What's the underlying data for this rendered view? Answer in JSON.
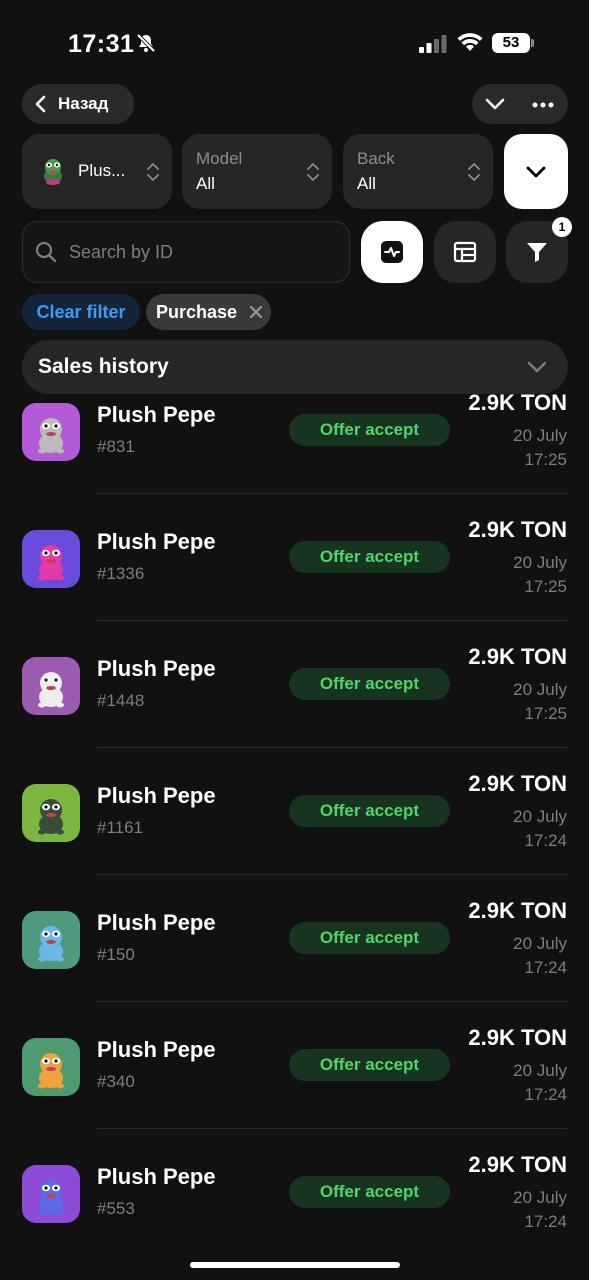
{
  "status_bar": {
    "time": "17:31",
    "battery": "53"
  },
  "nav": {
    "back_label": "Назад"
  },
  "filters": {
    "collection_value": "Plus...",
    "model_label": "Model",
    "model_value": "All",
    "back_label": "Back",
    "back_value": "All"
  },
  "search": {
    "placeholder": "Search by ID"
  },
  "filter_badge": "1",
  "chips": {
    "clear_label": "Clear filter",
    "purchase_label": "Purchase"
  },
  "section": {
    "title": "Sales history"
  },
  "colors": {
    "accent_blue": "#3d9bf2",
    "tag_green": "#4fd66a",
    "background": "#111111"
  },
  "sales": [
    {
      "name": "Plush Pepe",
      "number": "#831",
      "type": "Offer accept",
      "price": "2.9K TON",
      "date": "20 July",
      "time": "17:25",
      "bg": "#b35ad9",
      "toy": "#bbbbbb"
    },
    {
      "name": "Plush Pepe",
      "number": "#1336",
      "type": "Offer accept",
      "price": "2.9K TON",
      "date": "20 July",
      "time": "17:25",
      "bg": "#6a4bdc",
      "toy": "#e23aa8"
    },
    {
      "name": "Plush Pepe",
      "number": "#1448",
      "type": "Offer accept",
      "price": "2.9K TON",
      "date": "20 July",
      "time": "17:25",
      "bg": "#9a5bb0",
      "toy": "#eeeeee"
    },
    {
      "name": "Plush Pepe",
      "number": "#1161",
      "type": "Offer accept",
      "price": "2.9K TON",
      "date": "20 July",
      "time": "17:24",
      "bg": "#7bb63f",
      "toy": "#3c4c3c"
    },
    {
      "name": "Plush Pepe",
      "number": "#150",
      "type": "Offer accept",
      "price": "2.9K TON",
      "date": "20 July",
      "time": "17:24",
      "bg": "#4f9a7e",
      "toy": "#6ab8e8"
    },
    {
      "name": "Plush Pepe",
      "number": "#340",
      "type": "Offer accept",
      "price": "2.9K TON",
      "date": "20 July",
      "time": "17:24",
      "bg": "#4f9a70",
      "toy": "#f2a23a"
    },
    {
      "name": "Plush Pepe",
      "number": "#553",
      "type": "Offer accept",
      "price": "2.9K TON",
      "date": "20 July",
      "time": "17:24",
      "bg": "#8d4bd6",
      "toy": "#5a6ae8"
    }
  ]
}
